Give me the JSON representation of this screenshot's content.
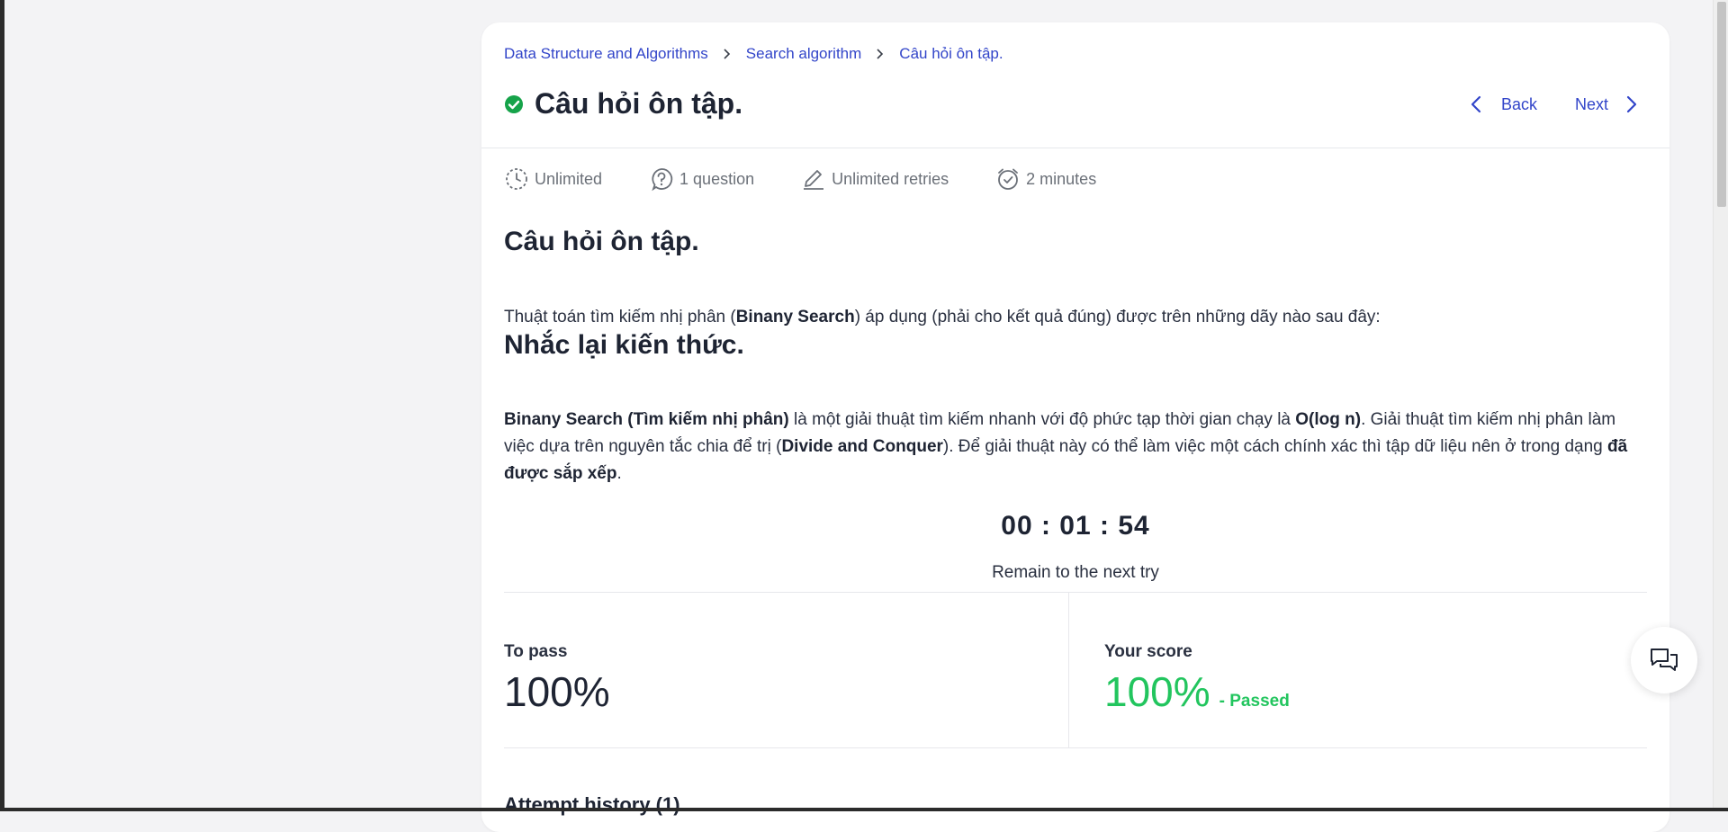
{
  "breadcrumb": {
    "items": [
      "Data Structure and Algorithms",
      "Search algorithm",
      "Câu hỏi ôn tập."
    ]
  },
  "header": {
    "title": "Câu hỏi ôn tập.",
    "back_label": "Back",
    "next_label": "Next"
  },
  "meta": {
    "time_limit": "Unlimited",
    "questions": "1 question",
    "retries": "Unlimited retries",
    "duration": "2 minutes"
  },
  "content": {
    "heading1": "Câu hỏi ôn tập.",
    "question_before": "Thuật toán tìm kiếm nhị phân (",
    "question_bold": "Binany Search",
    "question_after": ") áp dụng (phải cho kết quả đúng) được trên những dãy nào sau đây:",
    "heading2": "Nhắc lại kiến thức.",
    "p2_bold1": "Binany Search (Tìm kiếm nhị phân)",
    "p2_text1": " là một giải thuật tìm kiếm nhanh với độ phức tạp thời gian chạy là ",
    "p2_bold2": "O(log n)",
    "p2_text2": ". Giải thuật tìm kiếm nhị phân làm việc dựa trên nguyên tắc chia để trị (",
    "p2_bold3": "Divide and Conquer",
    "p2_text3": "). Để giải thuật này có thể làm việc một cách chính xác thì tập dữ liệu nên ở trong dạng ",
    "p2_bold4": "đã được sắp xếp",
    "p2_text4": "."
  },
  "timer": {
    "value": "00 : 01 : 54",
    "caption": "Remain to the next try"
  },
  "score": {
    "to_pass_label": "To pass",
    "to_pass_value": "100%",
    "your_score_label": "Your score",
    "your_score_value": "100%",
    "status": "- Passed"
  },
  "attempts": {
    "title": "Attempt history (1)"
  },
  "colors": {
    "accent": "#3245c9",
    "success": "#22c55e",
    "check": "#16a34a"
  }
}
